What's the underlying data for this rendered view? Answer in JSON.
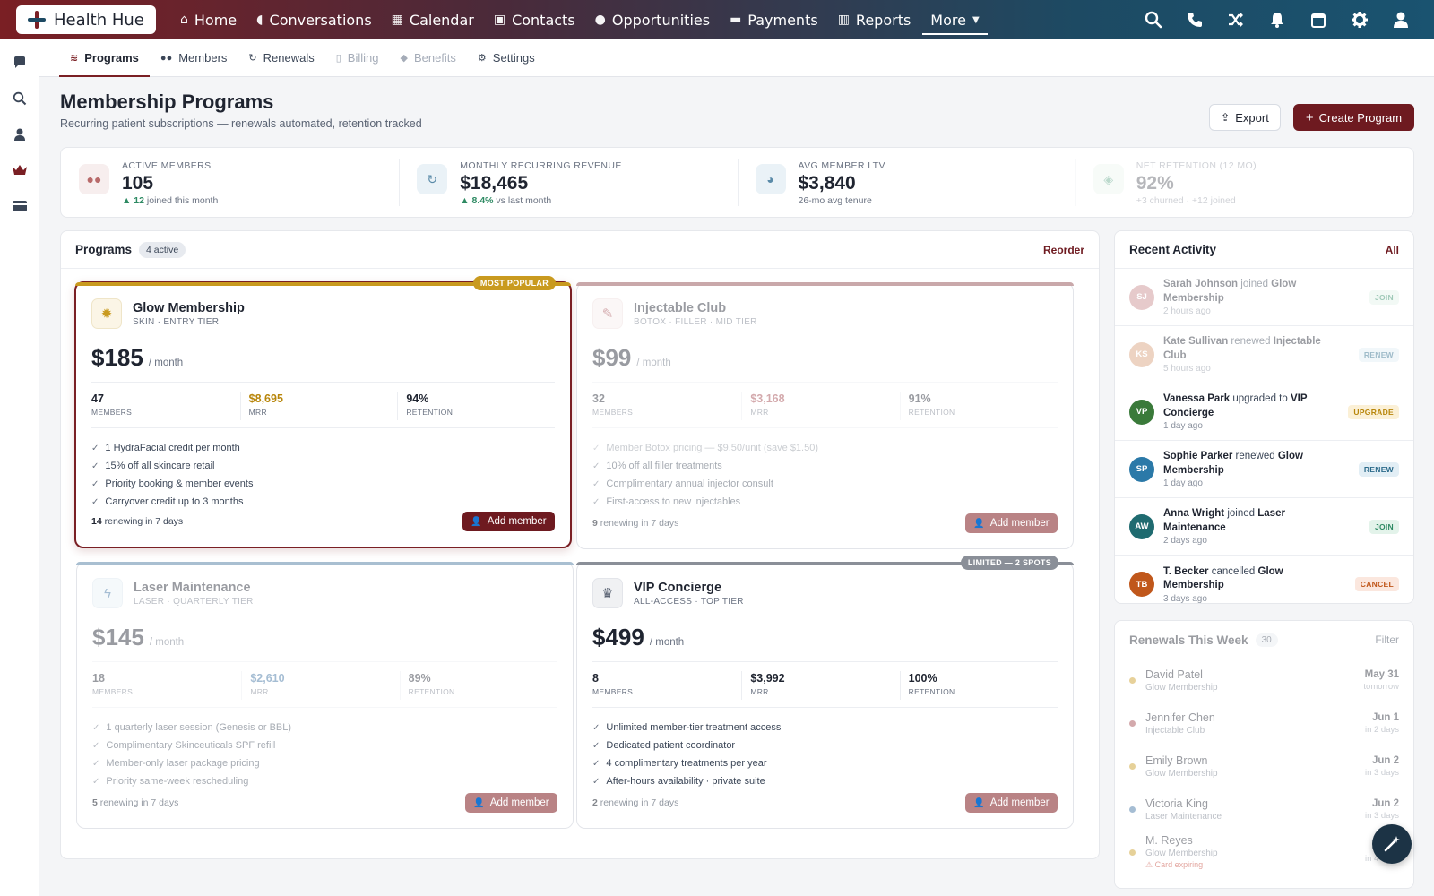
{
  "brand": {
    "name": "Health Hue"
  },
  "nav": {
    "items": [
      {
        "label": "Home",
        "icon": "⌂"
      },
      {
        "label": "Conversations",
        "icon": "💬"
      },
      {
        "label": "Calendar",
        "icon": "▦"
      },
      {
        "label": "Contacts",
        "icon": "▣"
      },
      {
        "label": "Opportunities",
        "icon": "●"
      },
      {
        "label": "Payments",
        "icon": "▬"
      },
      {
        "label": "Reports",
        "icon": "▥"
      }
    ],
    "more": "More",
    "icons": [
      "search-icon",
      "phone-icon",
      "shuffle-icon",
      "bell-icon",
      "calendar-icon",
      "gear-icon",
      "user-icon"
    ]
  },
  "subtabs": [
    {
      "label": "Programs",
      "icon": "≋"
    },
    {
      "label": "Members",
      "icon": "👥"
    },
    {
      "label": "Renewals",
      "icon": "↻"
    },
    {
      "label": "Billing",
      "icon": "▯"
    },
    {
      "label": "Benefits",
      "icon": "◆"
    },
    {
      "label": "Settings",
      "icon": "⚙"
    }
  ],
  "header": {
    "title": "Membership Programs",
    "subtitle": "Recurring patient subscriptions — renewals automated, retention tracked",
    "export": "Export",
    "create": "Create Program"
  },
  "stats": [
    {
      "label": "ACTIVE MEMBERS",
      "value": "105",
      "delta": "▲ 12",
      "sub": " joined this month"
    },
    {
      "label": "MONTHLY RECURRING REVENUE",
      "value": "$18,465",
      "delta": "▲ 8.4%",
      "sub": " vs last month"
    },
    {
      "label": "AVG MEMBER LTV",
      "value": "$3,840",
      "delta": "",
      "sub": "26-mo avg tenure"
    },
    {
      "label": "NET RETENTION (12 MO)",
      "value": "92%",
      "delta": "",
      "sub": "+3 churned · +12 joined"
    }
  ],
  "programs": {
    "title": "Programs",
    "badge": "4 active",
    "reorder": "Reorder",
    "add_label": "Add member",
    "cards": [
      {
        "name": "Glow Membership",
        "tier": "SKIN · ENTRY TIER",
        "price": "$185",
        "per": "/ month",
        "ribbon": "MOST POPULAR",
        "members": "47",
        "mrr": "$8,695",
        "retention": "94%",
        "features": [
          "1 HydraFacial credit per month",
          "15% off all skincare retail",
          "Priority booking & member events",
          "Carryover credit up to 3 months"
        ],
        "renewing_count": "14",
        "renewing_text": " renewing in 7 days"
      },
      {
        "name": "Injectable Club",
        "tier": "BOTOX · FILLER · MID TIER",
        "price": "$99",
        "per": "/ month",
        "ribbon": "",
        "members": "32",
        "mrr": "$3,168",
        "retention": "91%",
        "features": [
          "Member Botox pricing — $9.50/unit (save $1.50)",
          "10% off all filler treatments",
          "Complimentary annual injector consult",
          "First-access to new injectables"
        ],
        "renewing_count": "9",
        "renewing_text": " renewing in 7 days"
      },
      {
        "name": "Laser Maintenance",
        "tier": "LASER · QUARTERLY TIER",
        "price": "$145",
        "per": "/ month",
        "ribbon": "",
        "members": "18",
        "mrr": "$2,610",
        "retention": "89%",
        "features": [
          "1 quarterly laser session (Genesis or BBL)",
          "Complimentary Skinceuticals SPF refill",
          "Member-only laser package pricing",
          "Priority same-week rescheduling"
        ],
        "renewing_count": "5",
        "renewing_text": " renewing in 7 days"
      },
      {
        "name": "VIP Concierge",
        "tier": "ALL-ACCESS · TOP TIER",
        "price": "$499",
        "per": "/ month",
        "ribbon": "LIMITED — 2 SPOTS",
        "members": "8",
        "mrr": "$3,992",
        "retention": "100%",
        "features": [
          "Unlimited member-tier treatment access",
          "Dedicated patient coordinator",
          "4 complimentary treatments per year",
          "After-hours availability · private suite"
        ],
        "renewing_count": "2",
        "renewing_text": " renewing in 7 days"
      }
    ],
    "metric_labels": {
      "members": "MEMBERS",
      "mrr": "MRR",
      "retention": "RETENTION"
    }
  },
  "activity": {
    "title": "Recent Activity",
    "all": "All",
    "rows": [
      {
        "initials": "SJ",
        "color": "#c98b8d",
        "who": "Sarah Johnson",
        "verb": " joined ",
        "what": "Glow Membership",
        "time": "2 hours ago",
        "tag": "JOIN",
        "tag_bg": "#e3f3ea",
        "tag_fg": "#2e8a63"
      },
      {
        "initials": "KS",
        "color": "#d9a07a",
        "who": "Kate Sullivan",
        "verb": " renewed ",
        "what": "Injectable Club",
        "time": "5 hours ago",
        "tag": "RENEW",
        "tag_bg": "#e2eef5",
        "tag_fg": "#2b6a8a"
      },
      {
        "initials": "VP",
        "color": "#3a7a3a",
        "who": "Vanessa Park",
        "verb": " upgraded to ",
        "what": "VIP Concierge",
        "time": "1 day ago",
        "tag": "UPGRADE",
        "tag_bg": "#fbf0d6",
        "tag_fg": "#b8860b"
      },
      {
        "initials": "SP",
        "color": "#2b79a8",
        "who": "Sophie Parker",
        "verb": " renewed ",
        "what": "Glow Membership",
        "time": "1 day ago",
        "tag": "RENEW",
        "tag_bg": "#e2eef5",
        "tag_fg": "#2b6a8a"
      },
      {
        "initials": "AW",
        "color": "#1f6b70",
        "who": "Anna Wright",
        "verb": " joined ",
        "what": "Laser Maintenance",
        "time": "2 days ago",
        "tag": "JOIN",
        "tag_bg": "#e3f3ea",
        "tag_fg": "#2e8a63"
      },
      {
        "initials": "TB",
        "color": "#c0571b",
        "who": "T. Becker",
        "verb": " cancelled ",
        "what": "Glow Membership",
        "time": "3 days ago",
        "tag": "CANCEL",
        "tag_bg": "#fbe7de",
        "tag_fg": "#c0571b"
      }
    ]
  },
  "renewals": {
    "title": "Renewals This Week",
    "count": "30",
    "filter": "Filter",
    "rows": [
      {
        "name": "David Patel",
        "program": "Glow Membership",
        "date": "May 31",
        "when": "tomorrow",
        "dot": "#c99a1f",
        "warn": ""
      },
      {
        "name": "Jennifer Chen",
        "program": "Injectable Club",
        "date": "Jun 1",
        "when": "in 2 days",
        "dot": "#a0424a",
        "warn": ""
      },
      {
        "name": "Emily Brown",
        "program": "Glow Membership",
        "date": "Jun 2",
        "when": "in 3 days",
        "dot": "#c99a1f",
        "warn": ""
      },
      {
        "name": "Victoria King",
        "program": "Laser Maintenance",
        "date": "Jun 2",
        "when": "in 3 days",
        "dot": "#3a6fa0",
        "warn": ""
      },
      {
        "name": "M. Reyes",
        "program": "Glow Membership",
        "date": "Jun 3",
        "when": "in 4 days",
        "dot": "#c99a1f",
        "warn": "⚠ Card expiring"
      }
    ]
  },
  "colors": {
    "brand": "#6e1a20",
    "gold": "#c99a1f"
  }
}
